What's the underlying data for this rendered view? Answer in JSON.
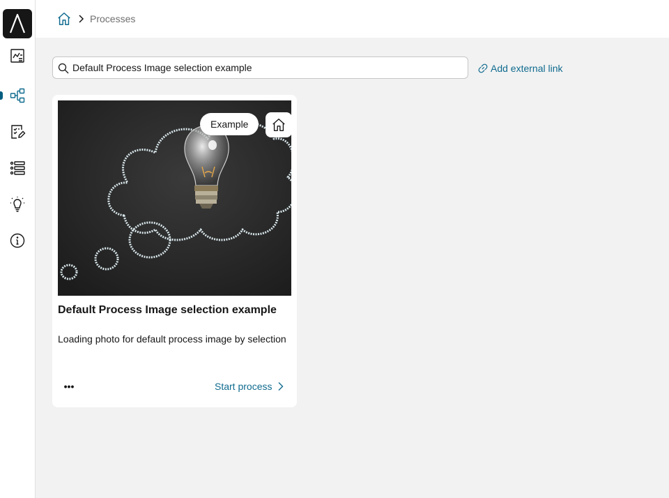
{
  "app": {
    "logo_glyph": "/\\"
  },
  "sidebar": {
    "items": [
      {
        "name": "dashboard",
        "icon": "chart-board-icon",
        "active": false
      },
      {
        "name": "processes",
        "icon": "process-flow-icon",
        "active": true
      },
      {
        "name": "tasks",
        "icon": "task-edit-icon",
        "active": false
      },
      {
        "name": "lists",
        "icon": "list-icon",
        "active": false
      },
      {
        "name": "ideas",
        "icon": "lightbulb-icon",
        "active": false
      },
      {
        "name": "info",
        "icon": "info-icon",
        "active": false
      }
    ],
    "accent_color": "#0f6b8f"
  },
  "breadcrumb": {
    "home_icon": "home-icon",
    "current": "Processes"
  },
  "search": {
    "value": "Default Process Image selection example",
    "placeholder": ""
  },
  "external_link": {
    "label": "Add external link",
    "icon": "link-icon"
  },
  "card": {
    "tag": "Example",
    "home_icon": "home-icon",
    "title": "Default Process Image selection example",
    "description": "Loading photo for default process image by selection",
    "more_label": "•••",
    "start_label": "Start process"
  },
  "colors": {
    "link": "#0f6b8f",
    "background": "#f2f2f2",
    "surface": "#ffffff"
  }
}
